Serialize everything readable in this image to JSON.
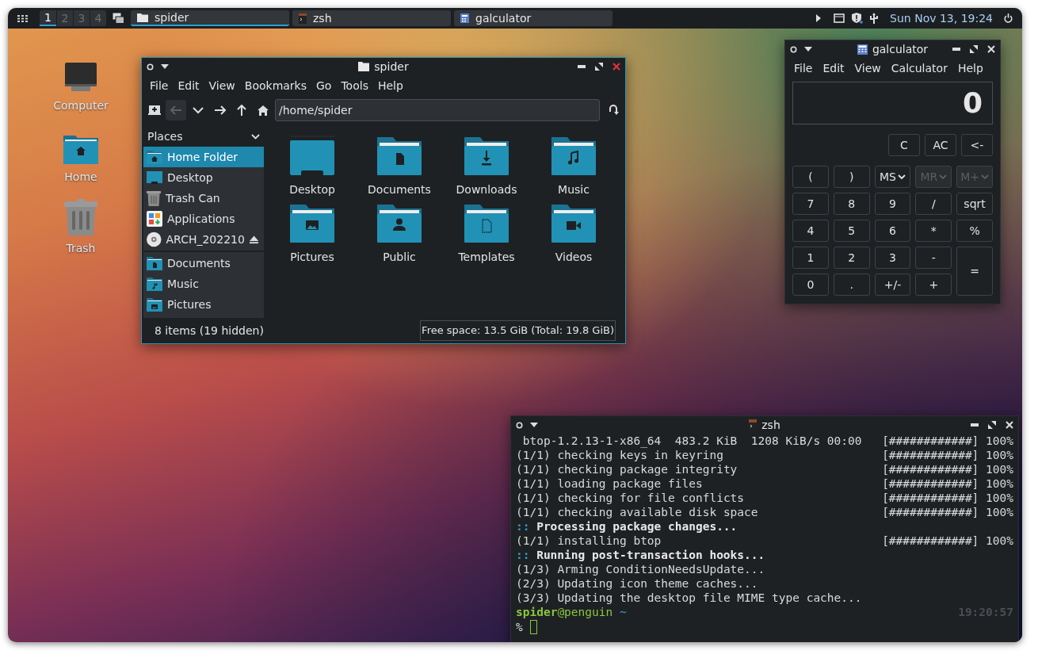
{
  "taskbar": {
    "workspaces": [
      {
        "label": "1",
        "selected": true
      },
      {
        "label": "2",
        "selected": false
      },
      {
        "label": "3",
        "selected": false
      },
      {
        "label": "4",
        "selected": false
      }
    ],
    "tasks": [
      {
        "label": "spider",
        "kind": "folder",
        "selected": true
      },
      {
        "label": "zsh",
        "kind": "terminal",
        "selected": false
      },
      {
        "label": "galculator",
        "kind": "calculator",
        "selected": false
      }
    ],
    "clock": "Sun Nov 13, 19:24"
  },
  "desktop_icons": [
    {
      "label": "Computer",
      "kind": "computer"
    },
    {
      "label": "Home",
      "kind": "home"
    },
    {
      "label": "Trash",
      "kind": "trash"
    }
  ],
  "file_manager": {
    "title": "spider",
    "menu": [
      "File",
      "Edit",
      "View",
      "Bookmarks",
      "Go",
      "Tools",
      "Help"
    ],
    "path": "/home/spider",
    "places_header": "Places",
    "places": [
      {
        "label": "Home Folder",
        "kind": "home",
        "selected": true
      },
      {
        "label": "Desktop",
        "kind": "desktop",
        "selected": false
      },
      {
        "label": "Trash Can",
        "kind": "trash",
        "selected": false
      },
      {
        "label": "Applications",
        "kind": "apps",
        "selected": false
      },
      {
        "label": "ARCH_202210",
        "kind": "disc",
        "selected": false
      }
    ],
    "bookmarks": [
      {
        "label": "Documents",
        "kind": "documents",
        "selected": false
      },
      {
        "label": "Music",
        "kind": "music",
        "selected": false
      },
      {
        "label": "Pictures",
        "kind": "pictures",
        "selected": false
      }
    ],
    "items": [
      {
        "label": "Desktop",
        "kind": "desktop"
      },
      {
        "label": "Documents",
        "kind": "documents"
      },
      {
        "label": "Downloads",
        "kind": "downloads"
      },
      {
        "label": "Music",
        "kind": "music"
      },
      {
        "label": "Pictures",
        "kind": "pictures"
      },
      {
        "label": "Public",
        "kind": "public"
      },
      {
        "label": "Templates",
        "kind": "templates"
      },
      {
        "label": "Videos",
        "kind": "videos"
      }
    ],
    "status": "8 items (19 hidden)",
    "free_space": "Free space: 13.5 GiB (Total: 19.8 GiB)"
  },
  "calculator": {
    "title": "galculator",
    "menu": [
      "File",
      "Edit",
      "View",
      "Calculator",
      "Help"
    ],
    "display": "0",
    "top_buttons": [
      "C",
      "AC",
      "<-"
    ],
    "buttons": [
      {
        "label": "(",
        "kind": "plain",
        "disabled": false
      },
      {
        "label": ")",
        "kind": "plain",
        "disabled": false
      },
      {
        "label": "MS",
        "kind": "dropdown",
        "disabled": false
      },
      {
        "label": "MR",
        "kind": "dropdown",
        "disabled": true
      },
      {
        "label": "M+",
        "kind": "dropdown",
        "disabled": true
      },
      {
        "label": "7",
        "kind": "plain",
        "disabled": false
      },
      {
        "label": "8",
        "kind": "plain",
        "disabled": false
      },
      {
        "label": "9",
        "kind": "plain",
        "disabled": false
      },
      {
        "label": "/",
        "kind": "plain",
        "disabled": false
      },
      {
        "label": "sqrt",
        "kind": "plain",
        "disabled": false
      },
      {
        "label": "4",
        "kind": "plain",
        "disabled": false
      },
      {
        "label": "5",
        "kind": "plain",
        "disabled": false
      },
      {
        "label": "6",
        "kind": "plain",
        "disabled": false
      },
      {
        "label": "*",
        "kind": "plain",
        "disabled": false
      },
      {
        "label": "%",
        "kind": "plain",
        "disabled": false
      },
      {
        "label": "1",
        "kind": "plain",
        "disabled": false
      },
      {
        "label": "2",
        "kind": "plain",
        "disabled": false
      },
      {
        "label": "3",
        "kind": "plain",
        "disabled": false
      },
      {
        "label": "-",
        "kind": "plain",
        "disabled": false
      },
      {
        "label": "=",
        "kind": "tall",
        "disabled": false
      },
      {
        "label": "0",
        "kind": "plain",
        "disabled": false
      },
      {
        "label": ".",
        "kind": "plain",
        "disabled": false
      },
      {
        "label": "+/-",
        "kind": "plain",
        "disabled": false
      },
      {
        "label": "+",
        "kind": "plain",
        "disabled": false
      }
    ]
  },
  "terminal": {
    "title": "zsh",
    "lines": [
      {
        "kind": "progress",
        "text": " btop-1.2.13-1-x86_64  483.2 KiB  1208 KiB/s 00:00",
        "progress": "[############] 100%"
      },
      {
        "kind": "progress",
        "text": "(1/1) checking keys in keyring",
        "progress": "[############] 100%"
      },
      {
        "kind": "progress",
        "text": "(1/1) checking package integrity",
        "progress": "[############] 100%"
      },
      {
        "kind": "progress",
        "text": "(1/1) loading package files",
        "progress": "[############] 100%"
      },
      {
        "kind": "progress",
        "text": "(1/1) checking for file conflicts",
        "progress": "[############] 100%"
      },
      {
        "kind": "progress",
        "text": "(1/1) checking available disk space",
        "progress": "[############] 100%"
      },
      {
        "kind": "heading",
        "marker": "::",
        "text": "Processing package changes..."
      },
      {
        "kind": "progress",
        "text": "(1/1) installing btop",
        "progress": "[############] 100%"
      },
      {
        "kind": "heading",
        "marker": "::",
        "text": "Running post-transaction hooks..."
      },
      {
        "kind": "plain",
        "text": "(1/3) Arming ConditionNeedsUpdate..."
      },
      {
        "kind": "plain",
        "text": "(2/3) Updating icon theme caches..."
      },
      {
        "kind": "plain",
        "text": "(3/3) Updating the desktop file MIME type cache..."
      }
    ],
    "prompt": {
      "user": "spider",
      "host": "@penguin",
      "dir": "~",
      "time": "19:20:57",
      "symbol": "%"
    }
  }
}
